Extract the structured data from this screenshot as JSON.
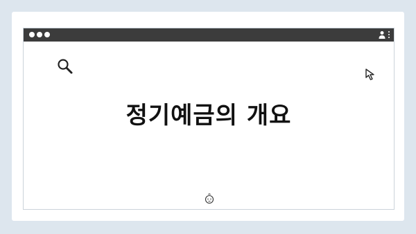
{
  "page": {
    "title": "정기예금의 개요"
  },
  "icons": {
    "search": "search-icon",
    "cursor": "cursor-arrow-icon",
    "baby": "baby-face-icon",
    "profile": "profile-icon",
    "menu": "kebab-menu-icon"
  },
  "colors": {
    "background": "#dde6ee",
    "titlebar": "#3c3c3c",
    "title_text": "#111111"
  }
}
